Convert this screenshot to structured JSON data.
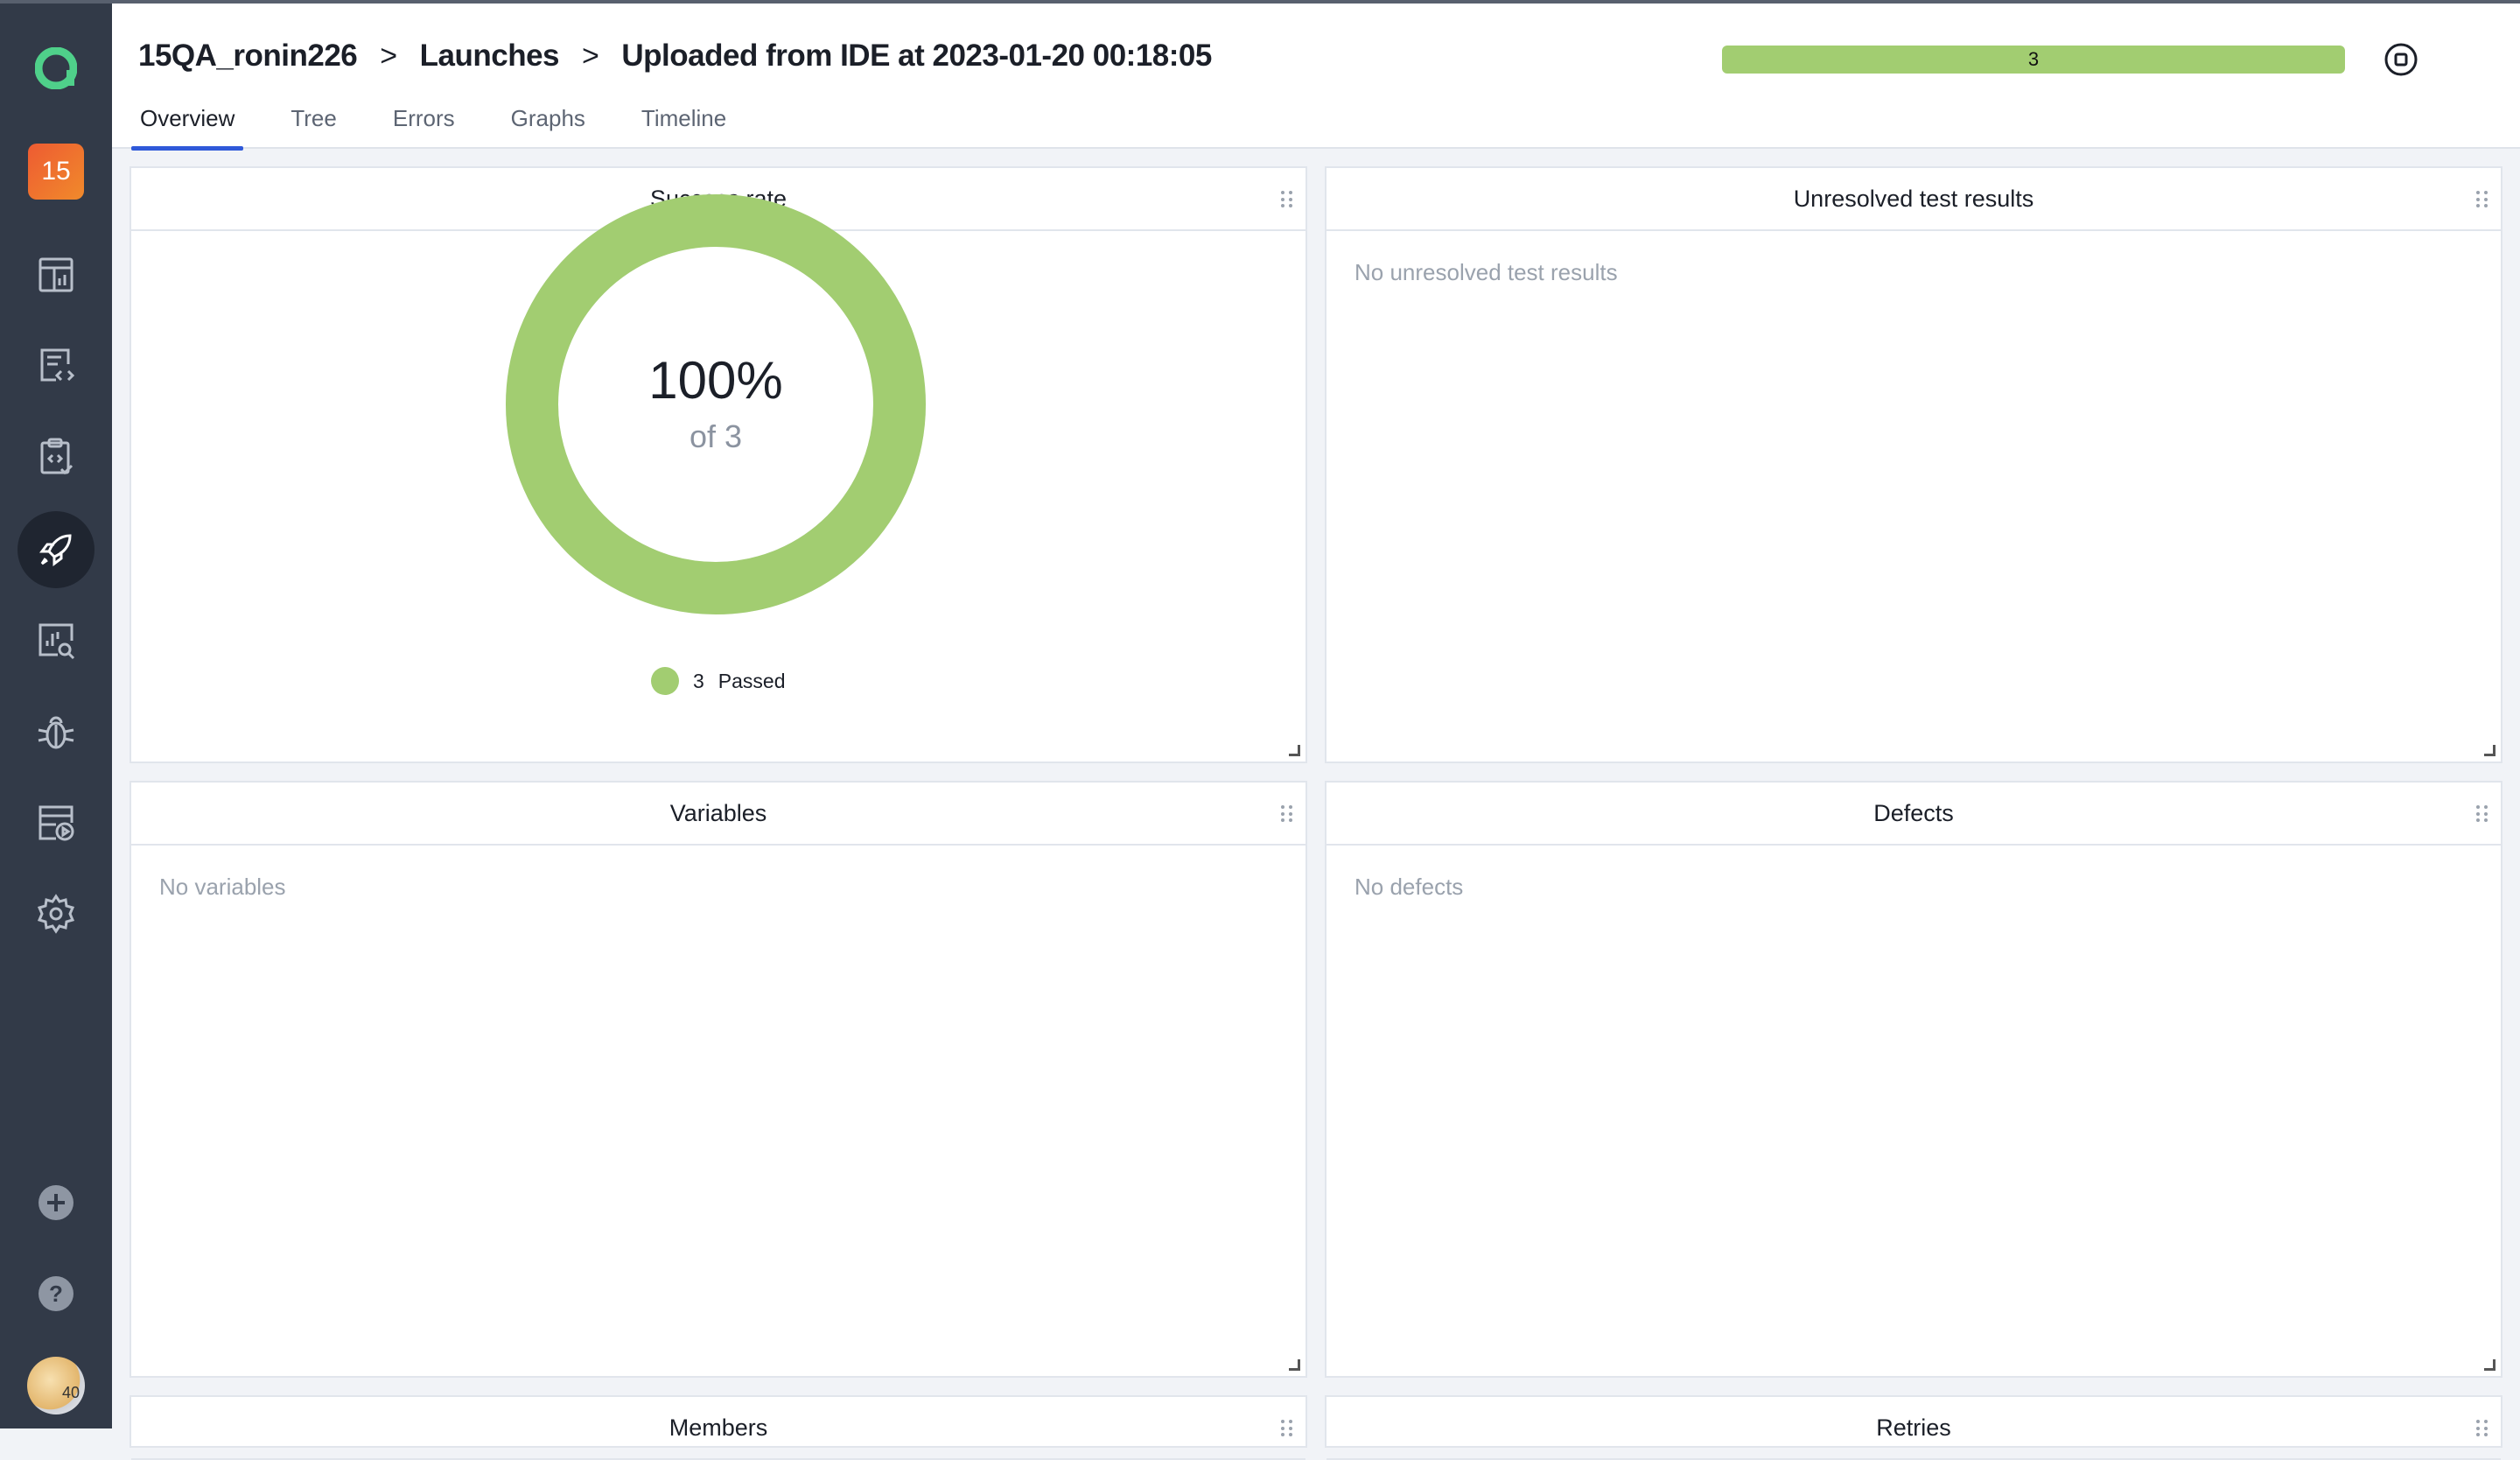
{
  "sidebar": {
    "project_badge": "15",
    "avatar_label": "40"
  },
  "header": {
    "breadcrumb": [
      "15QA_ronin226",
      "Launches",
      "Uploaded from IDE at 2023-01-20 00:18:05"
    ],
    "progress_count": "3",
    "progress_fraction": 1.0
  },
  "tabs": [
    {
      "label": "Overview",
      "active": true
    },
    {
      "label": "Tree"
    },
    {
      "label": "Errors"
    },
    {
      "label": "Graphs"
    },
    {
      "label": "Timeline"
    }
  ],
  "widgets": {
    "success_rate": {
      "title": "Success rate",
      "percent": "100%",
      "of_text": "of 3",
      "legend_count": "3",
      "legend_label": "Passed",
      "passed_fraction": 1.0
    },
    "unresolved": {
      "title": "Unresolved test results",
      "empty": "No unresolved test results"
    },
    "variables": {
      "title": "Variables",
      "empty": "No variables"
    },
    "defects": {
      "title": "Defects",
      "empty": "No defects"
    },
    "members": {
      "title": "Members"
    },
    "retries": {
      "title": "Retries"
    }
  },
  "colors": {
    "passed": "#a2cd71",
    "sidebar": "#323a48",
    "accent_tab": "#2f59d9"
  },
  "icons": [
    "dashboard-icon",
    "test-cases-icon",
    "test-plans-icon",
    "launches-icon",
    "analytics-icon",
    "defects-icon",
    "jobs-icon",
    "settings-icon",
    "add-icon",
    "help-icon"
  ]
}
